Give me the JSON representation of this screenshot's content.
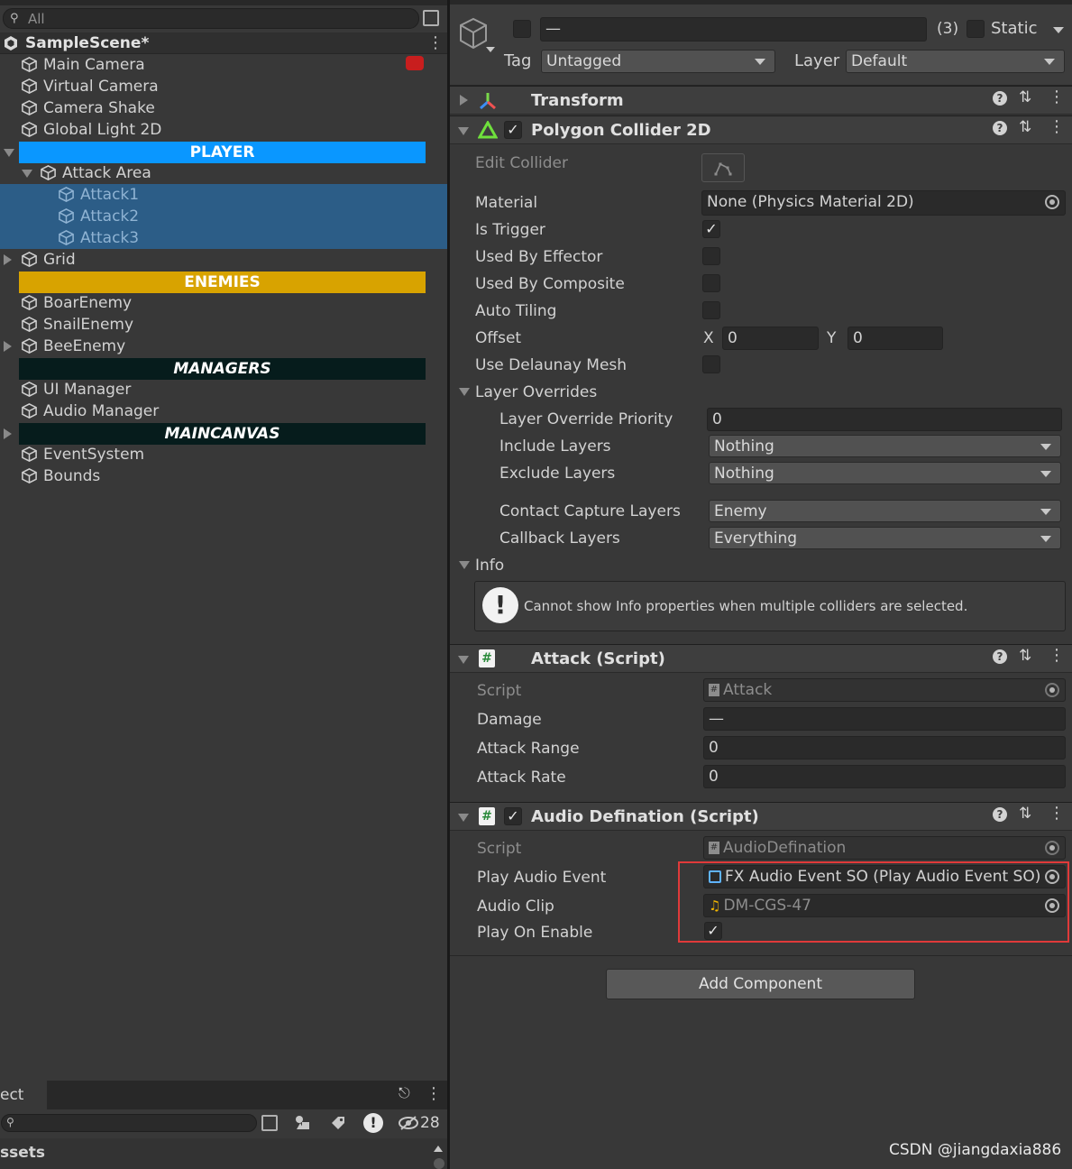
{
  "hierarchy": {
    "search_placeholder": "All",
    "scene_name": "SampleScene*",
    "items": [
      {
        "label": "Main Camera"
      },
      {
        "label": "Virtual Camera"
      },
      {
        "label": "Camera Shake"
      },
      {
        "label": "Global Light 2D"
      },
      {
        "label": "PLAYER",
        "bar_color": "#0a97ff"
      },
      {
        "label": "Attack Area"
      },
      {
        "label": "Attack1"
      },
      {
        "label": "Attack2"
      },
      {
        "label": "Attack3"
      },
      {
        "label": "Grid"
      },
      {
        "label": "ENEMIES",
        "bar_color": "#d8a300"
      },
      {
        "label": "BoarEnemy"
      },
      {
        "label": "SnailEnemy"
      },
      {
        "label": "BeeEnemy"
      },
      {
        "label": "MANAGERS",
        "bar_color": "#061c1c"
      },
      {
        "label": "UI Manager"
      },
      {
        "label": "Audio Manager"
      },
      {
        "label": "MAINCANVAS",
        "bar_color": "#061c1c"
      },
      {
        "label": "EventSystem"
      },
      {
        "label": "Bounds"
      }
    ]
  },
  "project": {
    "tab_label": "ect",
    "hidden_count": "28",
    "assets_label": "ssets"
  },
  "inspector": {
    "name_value": "—",
    "multi_count": "(3)",
    "static_label": "Static",
    "tag_label": "Tag",
    "tag_value": "Untagged",
    "layer_label": "Layer",
    "layer_value": "Default",
    "transform": {
      "title": "Transform"
    },
    "polygon_collider": {
      "title": "Polygon Collider 2D",
      "edit_collider_label": "Edit Collider",
      "material_label": "Material",
      "material_value": "None (Physics Material 2D)",
      "is_trigger_label": "Is Trigger",
      "used_by_effector_label": "Used By Effector",
      "used_by_composite_label": "Used By Composite",
      "auto_tiling_label": "Auto Tiling",
      "offset_label": "Offset",
      "offset_x_label": "X",
      "offset_x_value": "0",
      "offset_y_label": "Y",
      "offset_y_value": "0",
      "use_delaunay_label": "Use Delaunay Mesh",
      "layer_overrides_label": "Layer Overrides",
      "layer_override_priority_label": "Layer Override Priority",
      "layer_override_priority_value": "0",
      "include_layers_label": "Include Layers",
      "include_layers_value": "Nothing",
      "exclude_layers_label": "Exclude Layers",
      "exclude_layers_value": "Nothing",
      "contact_capture_label": "Contact Capture Layers",
      "contact_capture_value": "Enemy",
      "callback_layers_label": "Callback Layers",
      "callback_layers_value": "Everything",
      "info_label": "Info",
      "info_message": "Cannot show Info properties when multiple colliders are selected."
    },
    "attack_script": {
      "title": "Attack (Script)",
      "script_label": "Script",
      "script_value": "Attack",
      "damage_label": "Damage",
      "damage_value": "—",
      "attack_range_label": "Attack Range",
      "attack_range_value": "0",
      "attack_rate_label": "Attack Rate",
      "attack_rate_value": "0"
    },
    "audio_definition": {
      "title": "Audio Defination (Script)",
      "script_label": "Script",
      "script_value": "AudioDefination",
      "play_audio_event_label": "Play Audio Event",
      "play_audio_event_value": "FX Audio Event SO (Play Audio Event SO)",
      "audio_clip_label": "Audio Clip",
      "audio_clip_value": "DM-CGS-47",
      "play_on_enable_label": "Play On Enable"
    },
    "add_component_label": "Add Component"
  },
  "watermark": "CSDN @jiangdaxia886",
  "colors": {
    "highlight_box": "#e03a3a",
    "selection": "#2c5d87"
  }
}
